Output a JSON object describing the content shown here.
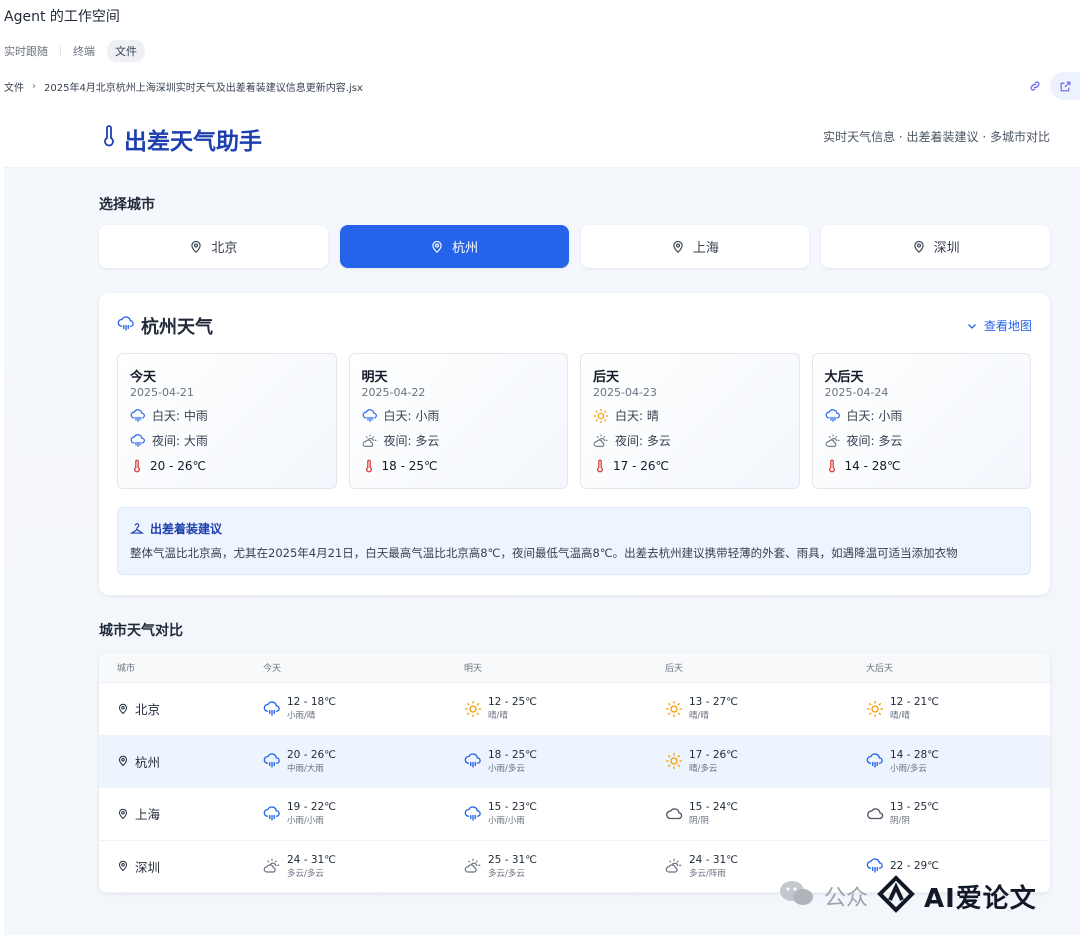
{
  "workspace": {
    "title": "Agent 的工作空间",
    "tabs": [
      "实时跟随",
      "终端",
      "文件"
    ]
  },
  "breadcrumb": {
    "root": "文件",
    "file": "2025年4月北京杭州上海深圳实时天气及出差着装建议信息更新内容.jsx"
  },
  "app": {
    "title": "出差天气助手",
    "subtitle": "实时天气信息 · 出差着装建议 · 多城市对比",
    "select_label": "选择城市",
    "cities": [
      "北京",
      "杭州",
      "上海",
      "深圳"
    ],
    "active_city": "杭州"
  },
  "weather": {
    "title": "杭州天气",
    "map_link": "查看地图",
    "days": [
      {
        "name": "今天",
        "date": "2025-04-21",
        "day": "白天: 中雨",
        "night": "夜间: 大雨",
        "temp": "20 - 26℃",
        "day_icon": "rain-icon",
        "night_icon": "rain-icon"
      },
      {
        "name": "明天",
        "date": "2025-04-22",
        "day": "白天: 小雨",
        "night": "夜间: 多云",
        "temp": "18 - 25℃",
        "day_icon": "rain-icon",
        "night_icon": "partly-cloudy-icon"
      },
      {
        "name": "后天",
        "date": "2025-04-23",
        "day": "白天: 晴",
        "night": "夜间: 多云",
        "temp": "17 - 26℃",
        "day_icon": "sun-icon",
        "night_icon": "partly-cloudy-icon"
      },
      {
        "name": "大后天",
        "date": "2025-04-24",
        "day": "白天: 小雨",
        "night": "夜间: 多云",
        "temp": "14 - 28℃",
        "day_icon": "rain-icon",
        "night_icon": "partly-cloudy-icon"
      }
    ],
    "advice_title": "出差着装建议",
    "advice_text": "整体气温比北京高，尤其在2025年4月21日，白天最高气温比北京高8℃，夜间最低气温高8℃。出差去杭州建议携带轻薄的外套、雨具，如遇降温可适当添加衣物"
  },
  "compare": {
    "title": "城市天气对比",
    "headers": [
      "城市",
      "今天",
      "明天",
      "后天",
      "大后天"
    ],
    "rows": [
      {
        "city": "北京",
        "cells": [
          {
            "temp": "12 - 18℃",
            "desc": "小雨/晴",
            "icon": "rain-icon"
          },
          {
            "temp": "12 - 25℃",
            "desc": "晴/晴",
            "icon": "sun-icon"
          },
          {
            "temp": "13 - 27℃",
            "desc": "晴/晴",
            "icon": "sun-icon"
          },
          {
            "temp": "12 - 21℃",
            "desc": "晴/晴",
            "icon": "sun-icon"
          }
        ]
      },
      {
        "city": "杭州",
        "cells": [
          {
            "temp": "20 - 26℃",
            "desc": "中雨/大雨",
            "icon": "rain-icon"
          },
          {
            "temp": "18 - 25℃",
            "desc": "小雨/多云",
            "icon": "rain-icon"
          },
          {
            "temp": "17 - 26℃",
            "desc": "晴/多云",
            "icon": "sun-icon"
          },
          {
            "temp": "14 - 28℃",
            "desc": "小雨/多云",
            "icon": "rain-icon"
          }
        ]
      },
      {
        "city": "上海",
        "cells": [
          {
            "temp": "19 - 22℃",
            "desc": "小雨/小雨",
            "icon": "rain-icon"
          },
          {
            "temp": "15 - 23℃",
            "desc": "小雨/小雨",
            "icon": "rain-icon"
          },
          {
            "temp": "15 - 24℃",
            "desc": "阴/阴",
            "icon": "cloud-icon"
          },
          {
            "temp": "13 - 25℃",
            "desc": "阴/阴",
            "icon": "cloud-icon"
          }
        ]
      },
      {
        "city": "深圳",
        "cells": [
          {
            "temp": "24 - 31℃",
            "desc": "多云/多云",
            "icon": "partly-cloudy-icon"
          },
          {
            "temp": "25 - 31℃",
            "desc": "多云/多云",
            "icon": "partly-cloudy-icon"
          },
          {
            "temp": "24 - 31℃",
            "desc": "多云/阵雨",
            "icon": "partly-cloudy-icon"
          },
          {
            "temp": "22 - 29℃",
            "desc": "",
            "icon": "rain-icon"
          }
        ]
      }
    ]
  },
  "watermark": {
    "text": "公众",
    "logo": "AI爱论文"
  },
  "colors": {
    "accent": "#2563eb",
    "title": "#1e40af",
    "sun": "#f59e0b",
    "thermo": "#dc2626"
  }
}
